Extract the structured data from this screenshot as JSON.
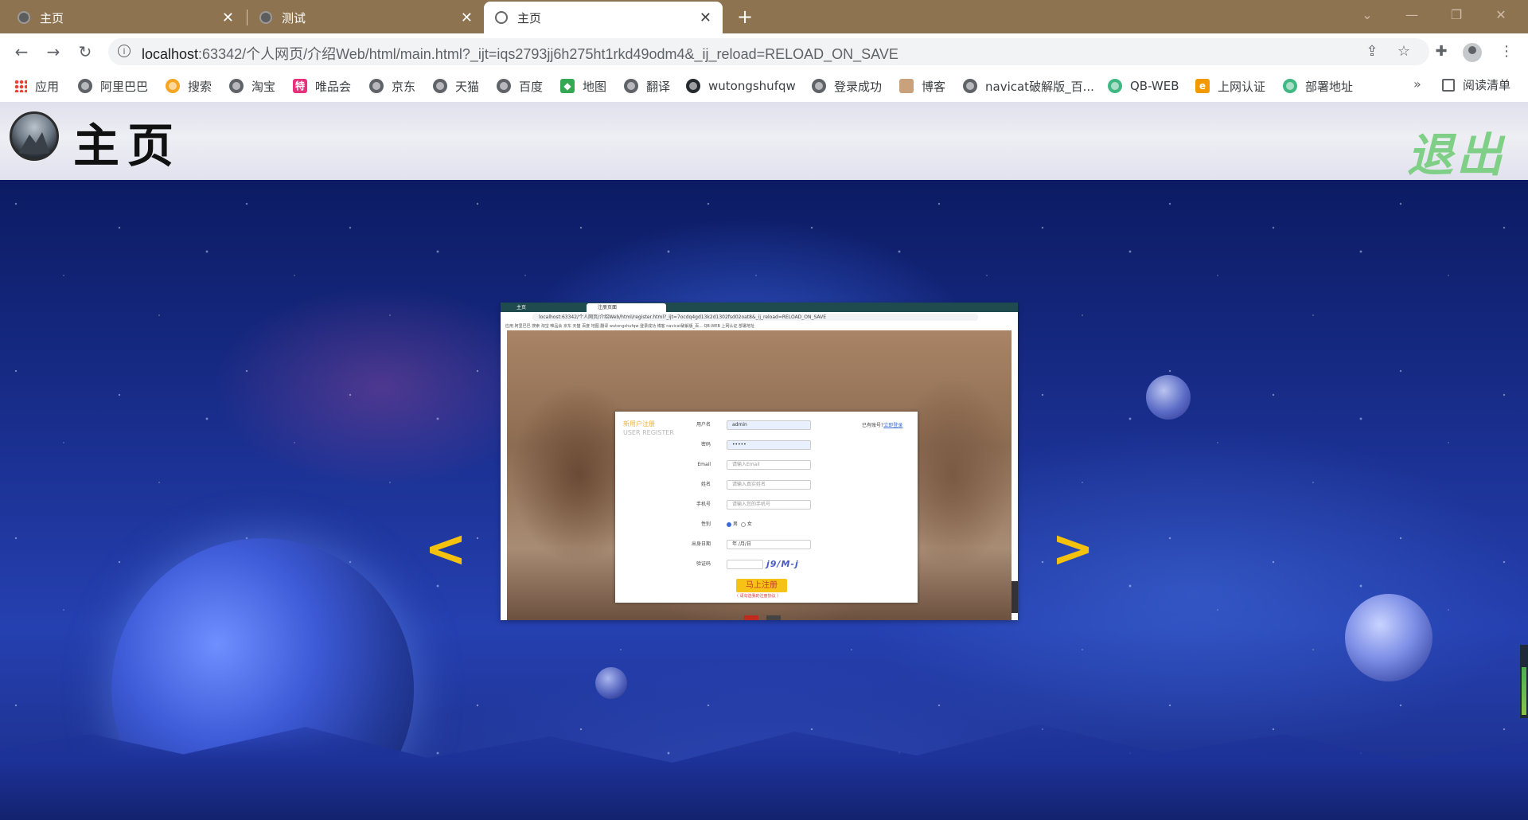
{
  "browser": {
    "tabs": [
      {
        "title": "主页",
        "active": false
      },
      {
        "title": "测试",
        "active": false
      },
      {
        "title": "主页",
        "active": true
      }
    ],
    "new_tab_glyph": "+",
    "url_host": "localhost",
    "url_path": ":63342/个人网页/介绍Web/html/main.html?_ijt=iqs2793jj6h275ht1rkd49odm4&_ij_reload=RELOAD_ON_SAVE",
    "bookmarks": [
      {
        "label": "应用",
        "icon": "apps-icon"
      },
      {
        "label": "阿里巴巴",
        "icon": "globe-icon"
      },
      {
        "label": "搜索",
        "icon": "search-icon"
      },
      {
        "label": "淘宝",
        "icon": "globe-icon"
      },
      {
        "label": "唯品会",
        "icon": "vip-icon"
      },
      {
        "label": "京东",
        "icon": "globe-icon"
      },
      {
        "label": "天猫",
        "icon": "globe-icon"
      },
      {
        "label": "百度",
        "icon": "globe-icon"
      },
      {
        "label": "地图",
        "icon": "map-icon"
      },
      {
        "label": "翻译",
        "icon": "globe-icon"
      },
      {
        "label": "wutongshufqw",
        "icon": "github-icon"
      },
      {
        "label": "登录成功",
        "icon": "globe-icon"
      },
      {
        "label": "博客",
        "icon": "blog-icon"
      },
      {
        "label": "navicat破解版_百...",
        "icon": "globe-icon"
      },
      {
        "label": "QB-WEB",
        "icon": "vue-icon"
      },
      {
        "label": "上网认证",
        "icon": "ep-icon"
      },
      {
        "label": "部署地址",
        "icon": "vue-icon"
      }
    ],
    "bookmarks_more": "»",
    "reading_list": "阅读清单"
  },
  "page": {
    "title": "主页",
    "logout": "退出",
    "arrow_left": "<",
    "arrow_right": ">"
  },
  "slide": {
    "tabs": [
      "主页",
      "注册页面"
    ],
    "url": "localhost:63342/个人网页/介绍Web/html/register.html?_ijt=7ocdq4gd13k2d1302fsd02oat8&_ij_reload=RELOAD_ON_SAVE",
    "bookmarks_line": "应用  阿里巴巴  搜索  淘宝  唯品会  京东  天猫  百度  地图  翻译  wutongshufqw  登录成功  博客  navicat破解版_百...  QB-WEB  上网认证  部署地址",
    "card_title": "新用户注册",
    "card_subtitle": "USER REGISTER",
    "login_prompt": "已有账号?",
    "login_link": "立即登录",
    "fields": [
      {
        "label": "用户名",
        "value": "admin",
        "filled": true
      },
      {
        "label": "密码",
        "value": "•••••",
        "filled": true
      },
      {
        "label": "Email",
        "value": "请输入Email",
        "filled": false
      },
      {
        "label": "姓名",
        "value": "请输入真实姓名",
        "filled": false
      },
      {
        "label": "手机号",
        "value": "请输入您的手机号",
        "filled": false
      }
    ],
    "gender_label": "性别",
    "gender_male": "男",
    "gender_female": "女",
    "birthday_label": "出身日期",
    "birthday_value": "年 /月/日",
    "captcha_label": "验证码",
    "captcha_text": "j9/M-j",
    "submit": "马上注册",
    "hint": "（ 请勾选我的注册协议 ）"
  },
  "colors": {
    "tab_strip": "#8e7351",
    "logout": "#7fcf86",
    "arrow": "#f4c20d",
    "space": "#1a2f8f"
  }
}
